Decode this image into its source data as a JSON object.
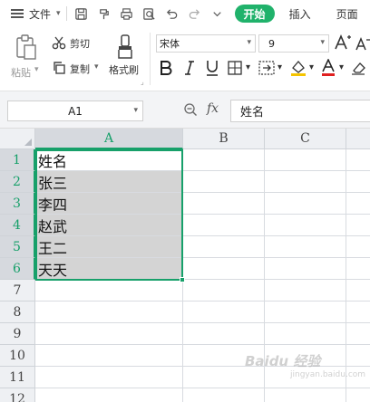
{
  "menubar": {
    "file_label": "文件",
    "quick_access_icons": [
      "save-icon",
      "format-painter-icon",
      "print-icon",
      "print-preview-icon",
      "undo-icon",
      "redo-icon",
      "customize-icon"
    ],
    "tabs": [
      "开始",
      "插入",
      "页面"
    ],
    "active_tab_color": "#20b26b"
  },
  "ribbon": {
    "paste_label": "粘贴",
    "cut_label": "剪切",
    "copy_label": "复制",
    "format_painter_label": "格式刷",
    "font_name": "宋体",
    "font_size": "9",
    "font_color": "#e02020",
    "highlight_color": "#f5c400"
  },
  "formula_bar": {
    "name_box": "A1",
    "fx_label": "fx",
    "formula": "姓名"
  },
  "sheet": {
    "columns": [
      "A",
      "B",
      "C"
    ],
    "active_column": "A",
    "rows": [
      "1",
      "2",
      "3",
      "4",
      "5",
      "6",
      "7",
      "8",
      "9",
      "10",
      "11",
      "12"
    ],
    "active_rows": [
      "1",
      "2",
      "3",
      "4",
      "5",
      "6"
    ],
    "column_a_values": [
      "姓名",
      "张三",
      "李四",
      "赵武",
      "王二",
      "天天"
    ],
    "selection": "A1:A6",
    "accent_color": "#17a06a"
  },
  "watermark": {
    "text": "Baidu 经验",
    "sub": "jingyan.baidu.com"
  }
}
